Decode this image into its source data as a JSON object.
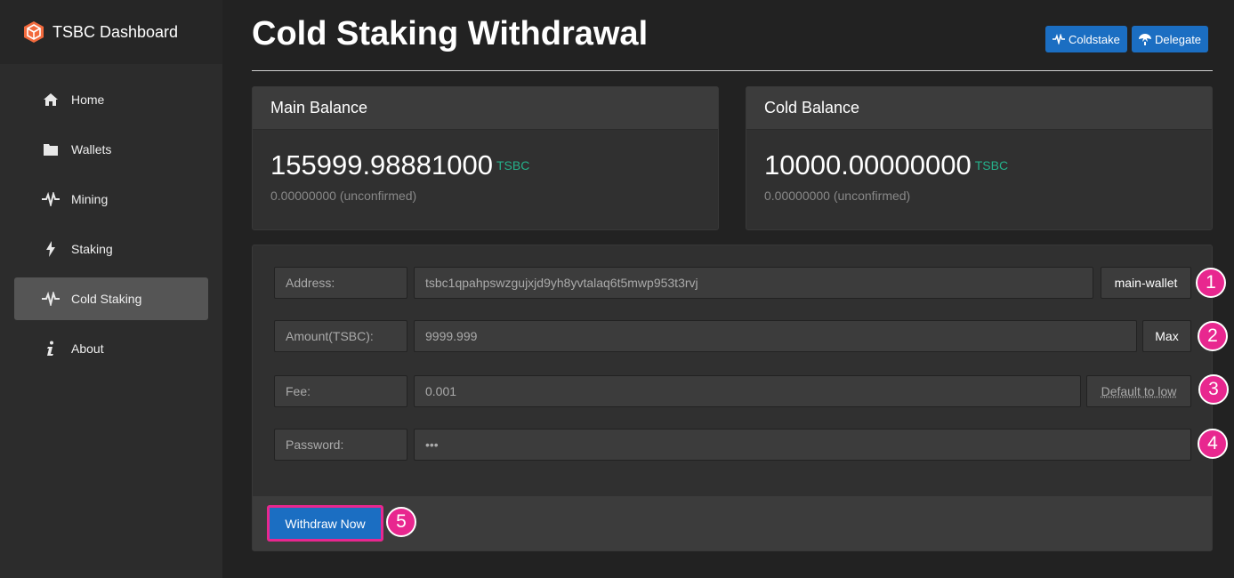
{
  "sidebar": {
    "brand": "TSBC Dashboard",
    "items": [
      {
        "label": "Home",
        "icon": "home-icon"
      },
      {
        "label": "Wallets",
        "icon": "folder-icon"
      },
      {
        "label": "Mining",
        "icon": "pulse-icon"
      },
      {
        "label": "Staking",
        "icon": "bolt-icon"
      },
      {
        "label": "Cold Staking",
        "icon": "pulse-icon",
        "active": true
      },
      {
        "label": "About",
        "icon": "info-icon"
      }
    ]
  },
  "header": {
    "title": "Cold Staking Withdrawal",
    "coldstake_label": "Coldstake",
    "delegate_label": "Delegate"
  },
  "main_balance": {
    "title": "Main Balance",
    "amount": "155999.98881000",
    "unit": "TSBC",
    "unconfirmed": "0.00000000 (unconfirmed)"
  },
  "cold_balance": {
    "title": "Cold Balance",
    "amount": "10000.00000000",
    "unit": "TSBC",
    "unconfirmed": "0.00000000 (unconfirmed)"
  },
  "form": {
    "address_label": "Address:",
    "address_value": "tsbc1qpahpswzgujxjd9yh8yvtalaq6t5mwp953t3rvj",
    "wallet_button": "main-wallet",
    "amount_label": "Amount(TSBC):",
    "amount_value": "9999.999",
    "max_button": "Max",
    "fee_label": "Fee:",
    "fee_value": "0.001",
    "default_fee_button": "Default to low",
    "password_label": "Password:",
    "password_value": "•••",
    "submit_label": "Withdraw Now"
  },
  "annotations": [
    "1",
    "2",
    "3",
    "4",
    "5"
  ],
  "colors": {
    "accent": "#1b6ec2",
    "highlight": "#e8278f",
    "currency": "#25b08a"
  }
}
